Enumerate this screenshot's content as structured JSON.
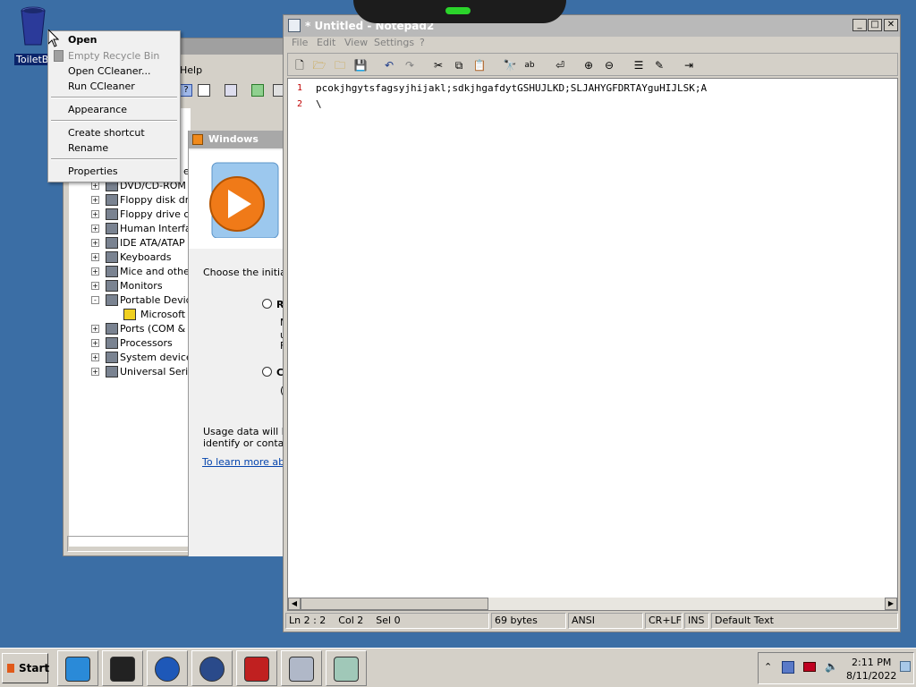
{
  "desktop": {
    "recycle_label": "ToiletBi",
    "colors": {
      "desktop": "#3b6ea5"
    }
  },
  "context_menu": {
    "items": [
      {
        "label": "Open",
        "bold": true,
        "disabled": false
      },
      {
        "label": "Empty Recycle Bin",
        "bold": false,
        "disabled": true
      },
      {
        "label": "Open CCleaner...",
        "bold": false,
        "disabled": false
      },
      {
        "label": "Run CCleaner",
        "bold": false,
        "disabled": false
      },
      {
        "label": "Appearance",
        "bold": false,
        "disabled": false
      },
      {
        "label": "Create shortcut",
        "bold": false,
        "disabled": false
      },
      {
        "label": "Rename",
        "bold": false,
        "disabled": false
      },
      {
        "label": "Properties",
        "bold": false,
        "disabled": false
      }
    ]
  },
  "device_manager": {
    "menu_help": "Help",
    "tree_items": [
      {
        "label": "DVD/CD-ROM d",
        "exp": "+",
        "icon": "disc-drive-icon"
      },
      {
        "label": "Floppy disk driv",
        "exp": "+",
        "icon": "floppy-controller-icon"
      },
      {
        "label": "Floppy drive co",
        "exp": "+",
        "icon": "floppy-drive-icon"
      },
      {
        "label": "Human Interfa",
        "exp": "+",
        "icon": "hid-icon"
      },
      {
        "label": "IDE ATA/ATAP",
        "exp": "+",
        "icon": "ide-icon"
      },
      {
        "label": "Keyboards",
        "exp": "+",
        "icon": "keyboard-icon"
      },
      {
        "label": "Mice and other",
        "exp": "+",
        "icon": "mouse-icon"
      },
      {
        "label": "Monitors",
        "exp": "+",
        "icon": "monitor-icon"
      },
      {
        "label": "Portable Devic",
        "exp": "-",
        "icon": "portable-device-icon"
      },
      {
        "label": "Microsoft W",
        "exp": "",
        "icon": "warning-device-icon"
      },
      {
        "label": "Ports (COM & L",
        "exp": "+",
        "icon": "port-icon"
      },
      {
        "label": "Processors",
        "exp": "+",
        "icon": "processor-icon"
      },
      {
        "label": "System devices",
        "exp": "+",
        "icon": "system-icon"
      },
      {
        "label": "Universal Seria",
        "exp": "+",
        "icon": "usb-icon"
      }
    ],
    "tree_partial_label": "e"
  },
  "wmp_dialog": {
    "title": "Windows Media",
    "prompt": "Choose the initial s",
    "option1_label": "R",
    "option1_line1": "M",
    "option1_line2": "u",
    "option1_line3": "F",
    "option2_label": "C",
    "option2_line1": "(",
    "usage_line1": "Usage data will be",
    "usage_line2": "identify or contact",
    "learn_more": "To learn more abou"
  },
  "notepad": {
    "title": "* Untitled - Notepad2",
    "menu": [
      "File",
      "Edit",
      "View",
      "Settings",
      "?"
    ],
    "lines": [
      {
        "num": "1",
        "text": "pcokjhgytsfagsyjhijakl;sdkjhgafdytGSHUJLKD;SLJAHYGFDRTAYguHIJLSK;A"
      },
      {
        "num": "2",
        "text": "\\"
      }
    ],
    "status": {
      "position": "Ln 2 : 2",
      "col": "Col 2",
      "sel": "Sel 0",
      "size": "69 bytes",
      "encoding": "ANSI",
      "eol": "CR+LF",
      "mode": "INS",
      "scheme": "Default Text"
    }
  },
  "taskbar": {
    "start_label": "Start",
    "clock_time": "2:11 PM",
    "clock_date": "8/11/2022",
    "apps": [
      "internet-explorer-icon",
      "device-icon",
      "media-player-icon",
      "network-globe-icon",
      "toolbox-icon",
      "notepad2-icon",
      "paper-icon"
    ]
  }
}
